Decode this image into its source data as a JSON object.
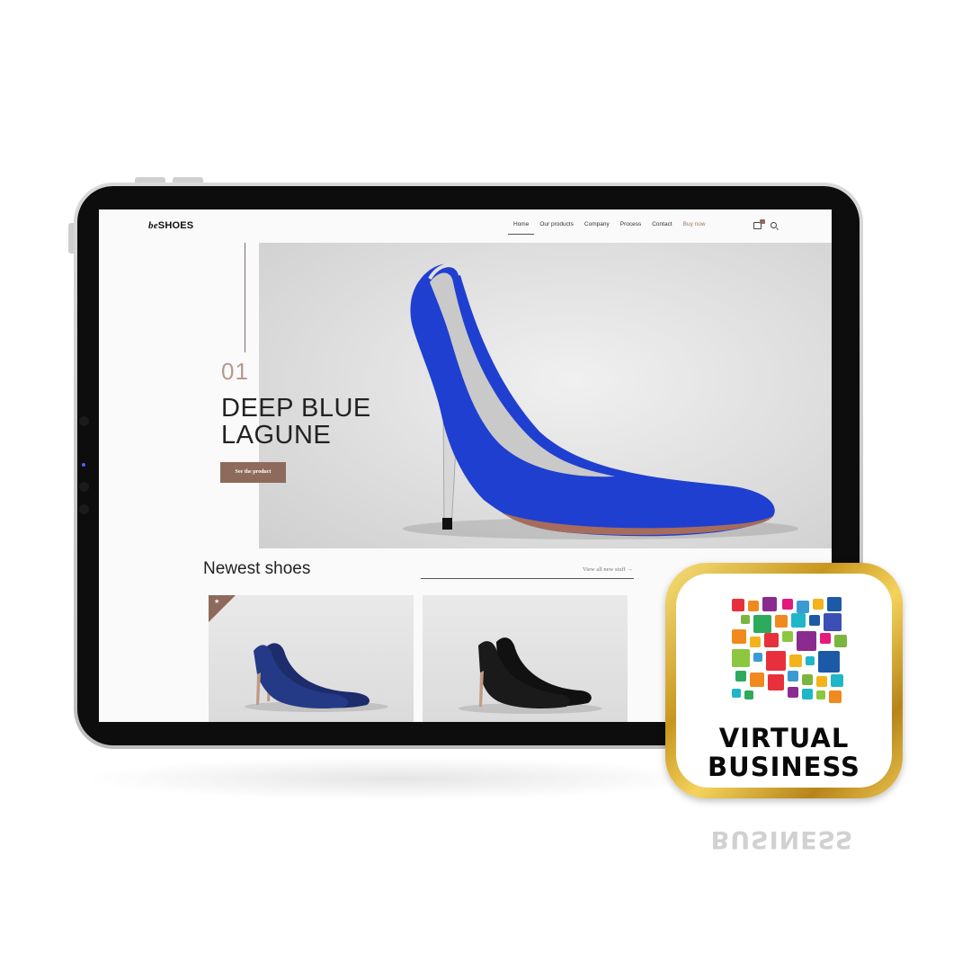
{
  "site": {
    "logo_prefix": "be",
    "logo_name": "SHOES",
    "nav": [
      "Home",
      "Our products",
      "Company",
      "Process",
      "Contact",
      "Buy now"
    ],
    "active_nav": "Home",
    "icons": [
      "bag-icon",
      "search-icon"
    ]
  },
  "hero": {
    "number": "01",
    "title_line1": "DEEP BLUE",
    "title_line2": "LAGUNE",
    "button": "See the product",
    "shoe_color": "#1f3fd0"
  },
  "newest": {
    "title": "Newest shoes",
    "view_all": "View all new stuff →",
    "products": [
      {
        "color": "#1d2c6b",
        "badge": "★"
      },
      {
        "color": "#111111"
      }
    ]
  },
  "badge": {
    "line1": "VIRTUAL",
    "line2": "BUSINESS",
    "reflection": "BUSINESS"
  },
  "colors": {
    "accent_brown": "#8d6a5b",
    "gold": "#d4a531"
  }
}
